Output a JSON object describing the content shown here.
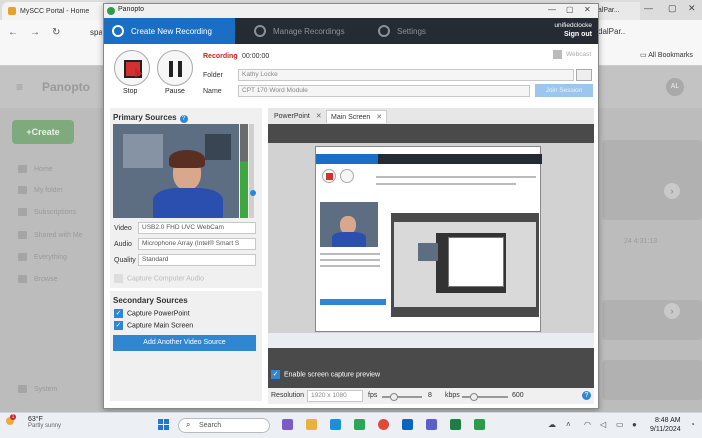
{
  "browser": {
    "tab_title": "MySCC Portal - Home",
    "tab2_title": "dalPar...",
    "address_partial": "spart",
    "all_bookmarks": "All Bookmarks"
  },
  "background_app": {
    "logo": "Panopto",
    "create_label": "Create",
    "avatar_initials": "AL",
    "sidebar": [
      "Home",
      "My folder",
      "Subscriptions",
      "Shared with Me",
      "Everything",
      "Browse",
      "System"
    ],
    "date_fragment": "24 4:31:13"
  },
  "dialog": {
    "title": "Panopto",
    "tabs": [
      "Create New Recording",
      "Manage Recordings",
      "Settings"
    ],
    "user": {
      "name": "unifiedclocke",
      "action": "Sign out"
    },
    "stop_label": "Stop",
    "pause_label": "Pause",
    "recording_label": "Recording",
    "recording_time": "00:00:00",
    "folder_label": "Folder",
    "folder_value": "Kathy Locke",
    "name_label": "Name",
    "name_value": "CPT 170 Word Module",
    "webcast_label": "Webcast",
    "join_label": "Join Session",
    "primary_sources_title": "Primary Sources",
    "video_label": "Video",
    "video_value": "USB2.0 FHD UVC WebCam",
    "audio_label": "Audio",
    "audio_value": "Microphone Array (Intel® Smart S",
    "quality_label": "Quality",
    "quality_value": "Standard",
    "capture_computer_audio": "Capture Computer Audio",
    "secondary_sources_title": "Secondary Sources",
    "capture_powerpoint": "Capture PowerPoint",
    "capture_main_screen": "Capture Main Screen",
    "add_video_source": "Add Another Video Source",
    "preview_tabs": [
      "PowerPoint",
      "Main Screen"
    ],
    "enable_preview": "Enable screen capture preview",
    "resolution_label": "Resolution",
    "resolution_value": "1920 x 1080",
    "fps_label": "fps",
    "fps_value": "8",
    "kbps_label": "kbps",
    "kbps_value": "600"
  },
  "taskbar": {
    "temp": "63°F",
    "weather": "Partly sunny",
    "search_placeholder": "Search",
    "time": "8:48 AM",
    "date": "9/11/2024"
  },
  "colors": {
    "accent": "#1a6fc4",
    "record_red": "#d62f2f",
    "header_dark": "#252b33"
  }
}
